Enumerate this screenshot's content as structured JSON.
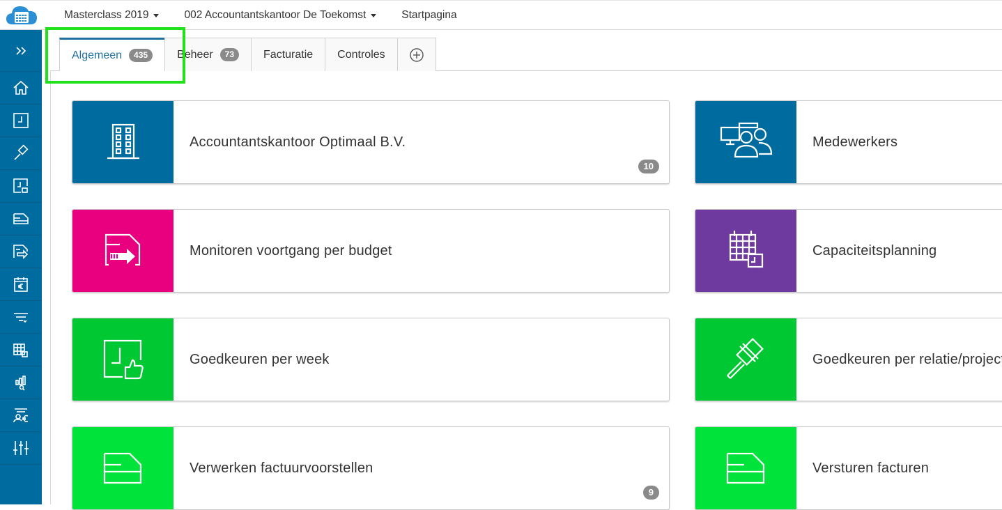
{
  "topbar": {
    "items": [
      {
        "label": "Masterclass 2019",
        "has_caret": true
      },
      {
        "label": "002 Accountantskantoor De Toekomst",
        "has_caret": true
      },
      {
        "label": "Startpagina",
        "has_caret": false
      }
    ]
  },
  "sidebar": {
    "icons": [
      "expand-icon",
      "home-icon",
      "timesheet-icon",
      "gavel-icon",
      "approve-hours-icon",
      "invoice-icon",
      "send-invoice-icon",
      "calendar-euro-icon",
      "filter-icon",
      "calendar-grid-icon",
      "chart-search-icon",
      "person-euro-icon",
      "sliders-icon"
    ]
  },
  "tabs": [
    {
      "label": "Algemeen",
      "badge": "435",
      "active": true
    },
    {
      "label": "Beheer",
      "badge": "73",
      "active": false
    },
    {
      "label": "Facturatie",
      "badge": "",
      "active": false
    },
    {
      "label": "Controles",
      "badge": "",
      "active": false
    }
  ],
  "tiles": [
    {
      "label": "Accountantskantoor Optimaal B.V.",
      "count": "10",
      "color": "#006b9e",
      "icon": "building-icon"
    },
    {
      "label": "Medewerkers",
      "count": "",
      "color": "#006b9e",
      "icon": "employees-icon"
    },
    {
      "label": "Monitoren voortgang per budget",
      "count": "",
      "color": "#e8007f",
      "icon": "budget-progress-icon"
    },
    {
      "label": "Capaciteitsplanning",
      "count": "",
      "color": "#6f3a9f",
      "icon": "capacity-calendar-icon"
    },
    {
      "label": "Goedkeuren per week",
      "count": "",
      "color": "#00c832",
      "icon": "approve-week-icon"
    },
    {
      "label": "Goedkeuren per relatie/project",
      "count": "",
      "color": "#00c832",
      "icon": "gavel-icon"
    },
    {
      "label": "Verwerken factuurvoorstellen",
      "count": "9",
      "color": "#00e33a",
      "icon": "invoice-proposal-icon"
    },
    {
      "label": "Versturen facturen",
      "count": "",
      "color": "#00e33a",
      "icon": "send-invoice-icon"
    }
  ]
}
